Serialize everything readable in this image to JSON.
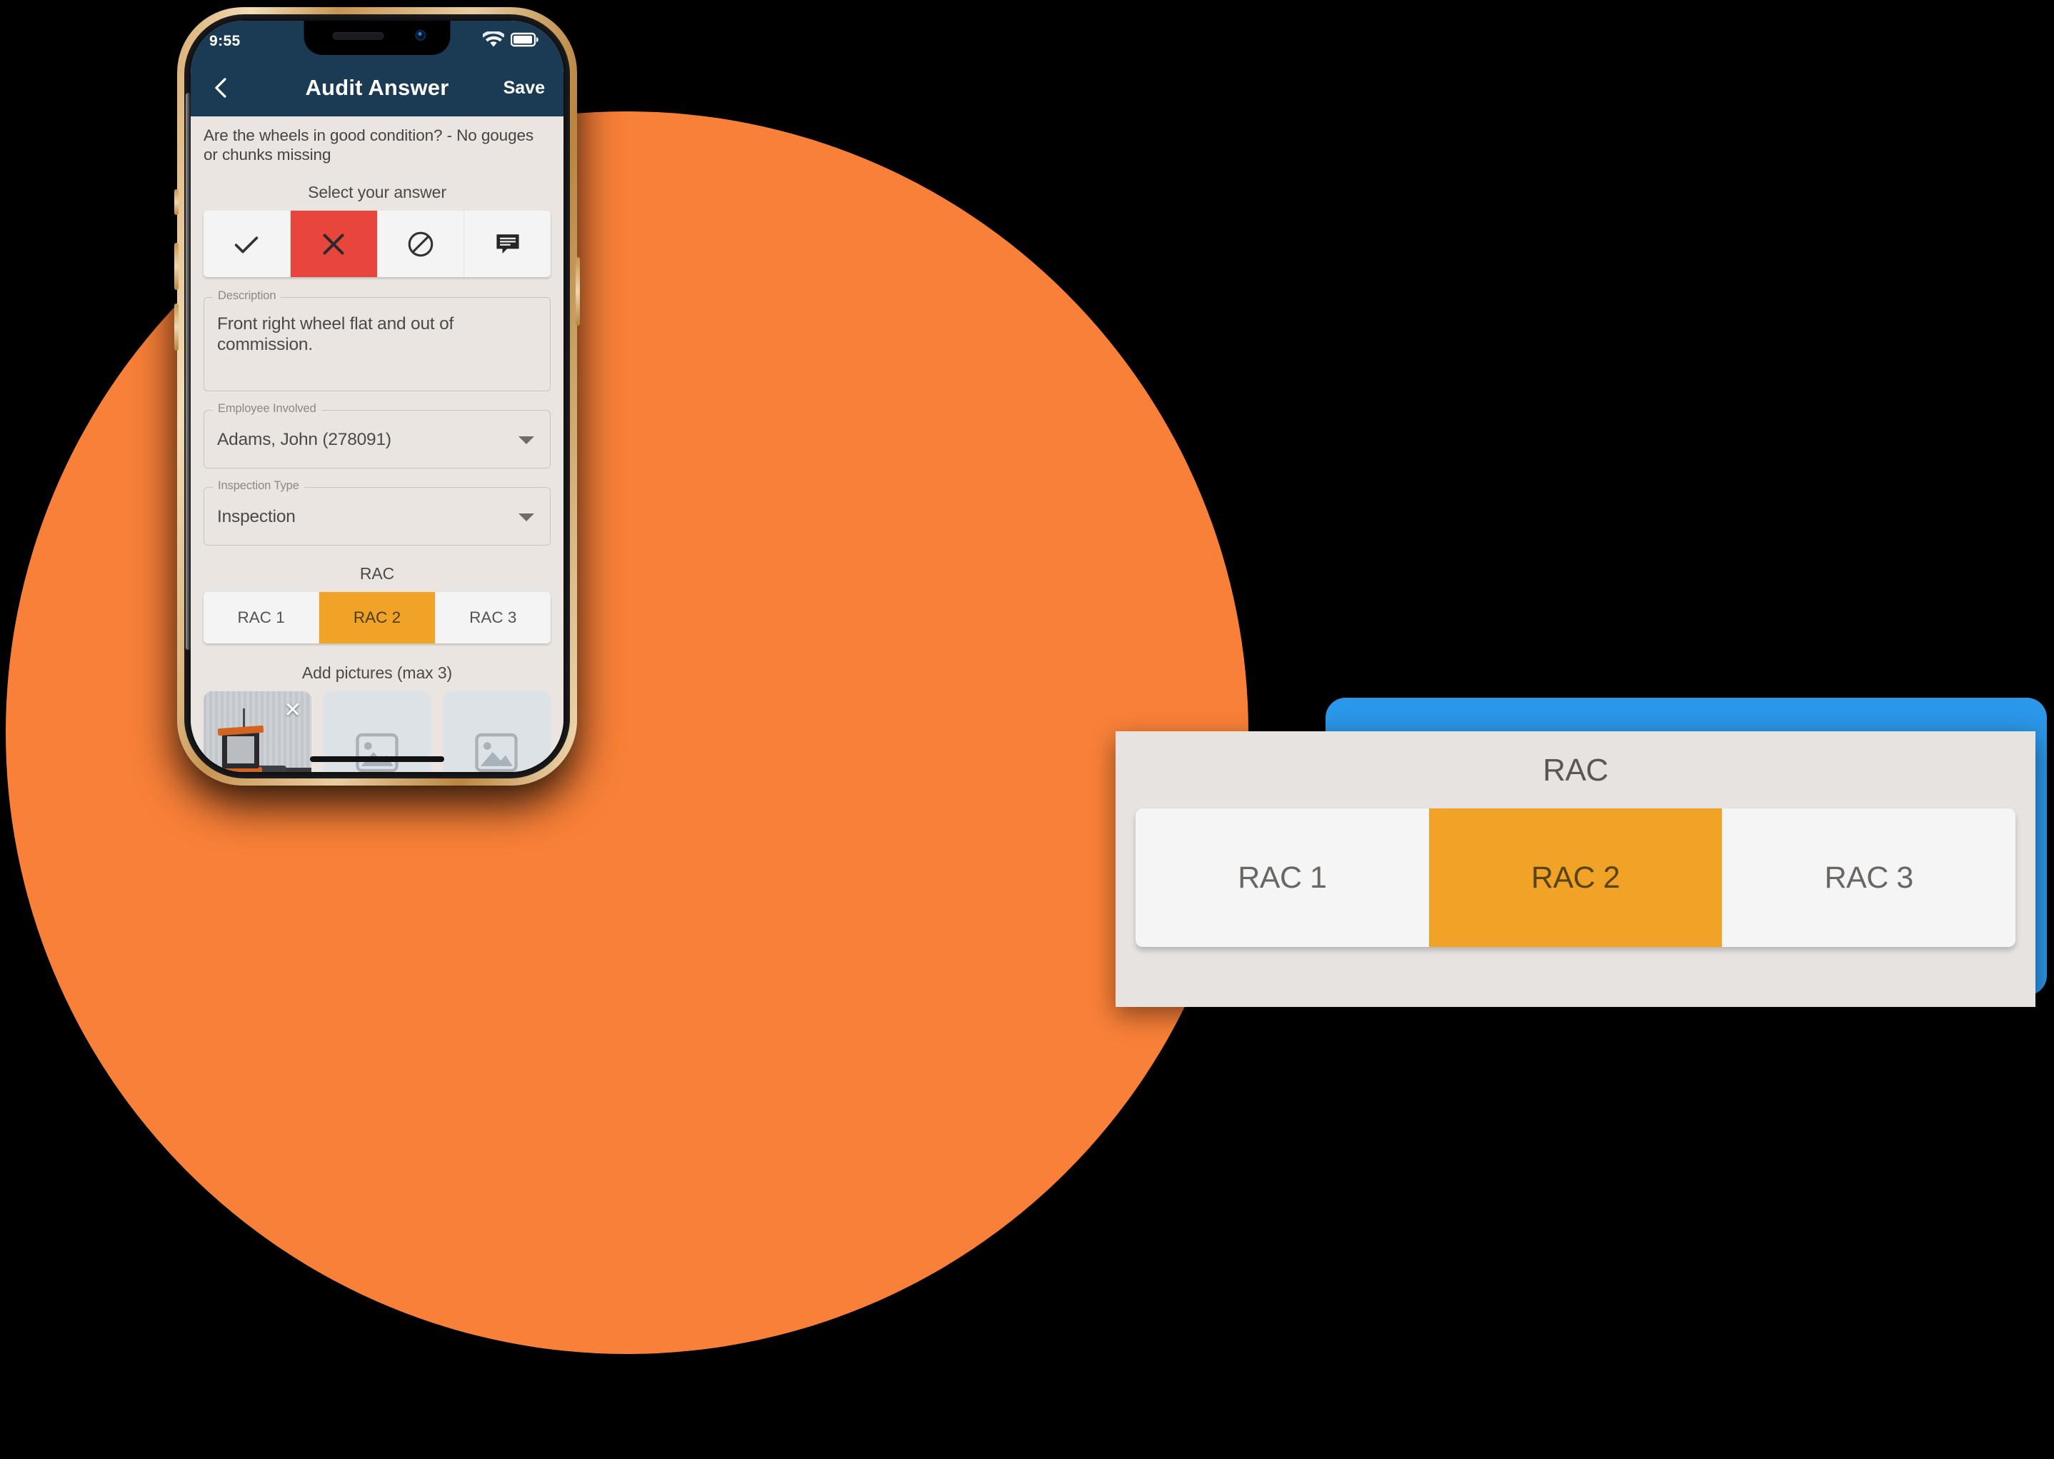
{
  "background": {
    "circle_color": "#F98038",
    "page_color": "#000000"
  },
  "phone": {
    "status_bar": {
      "time": "9:55",
      "wifi_icon": "wifi-icon",
      "battery_icon": "battery-icon",
      "bg_color": "#1B3A54"
    },
    "nav_bar": {
      "back_icon": "chevron-left-icon",
      "title": "Audit Answer",
      "save_label": "Save",
      "bg_color": "#1B3A54"
    },
    "content": {
      "question": "Are the wheels in good condition? - No gouges or chunks missing",
      "answer_section_label": "Select your answer",
      "answer_options": [
        {
          "icon": "check-icon",
          "selected": false,
          "bg": "#F4F4F4"
        },
        {
          "icon": "x-icon",
          "selected": true,
          "bg": "#E8453C"
        },
        {
          "icon": "no-entry-icon",
          "selected": false,
          "bg": "#F4F4F4"
        },
        {
          "icon": "comment-icon",
          "selected": false,
          "bg": "#F4F4F4"
        }
      ],
      "description": {
        "legend": "Description",
        "value": "Front right wheel flat and out of commission."
      },
      "employee_involved": {
        "legend": "Employee Involved",
        "value": "Adams, John (278091)",
        "caret_icon": "caret-down-icon"
      },
      "inspection_type": {
        "legend": "Inspection Type",
        "value": "Inspection",
        "caret_icon": "caret-down-icon"
      },
      "rac": {
        "label": "RAC",
        "options": [
          {
            "label": "RAC 1",
            "selected": false
          },
          {
            "label": "RAC 2",
            "selected": true
          },
          {
            "label": "RAC 3",
            "selected": false
          }
        ],
        "selected_color": "#F0A326"
      },
      "pictures": {
        "label": "Add pictures (max 3)",
        "max": 3,
        "slots": [
          {
            "type": "photo",
            "alt": "forklift-photo",
            "remove_icon": "close-icon"
          },
          {
            "type": "placeholder",
            "icon": "image-placeholder-icon"
          },
          {
            "type": "placeholder",
            "icon": "image-placeholder-icon"
          }
        ]
      }
    },
    "home_indicator": "home-indicator"
  },
  "callout": {
    "title": "RAC",
    "border_color": "#2B97E8",
    "panel_color": "#E7E3E0",
    "options": [
      {
        "label": "RAC 1",
        "selected": false
      },
      {
        "label": "RAC 2",
        "selected": true
      },
      {
        "label": "RAC 3",
        "selected": false
      }
    ],
    "selected_color": "#F0A326"
  }
}
